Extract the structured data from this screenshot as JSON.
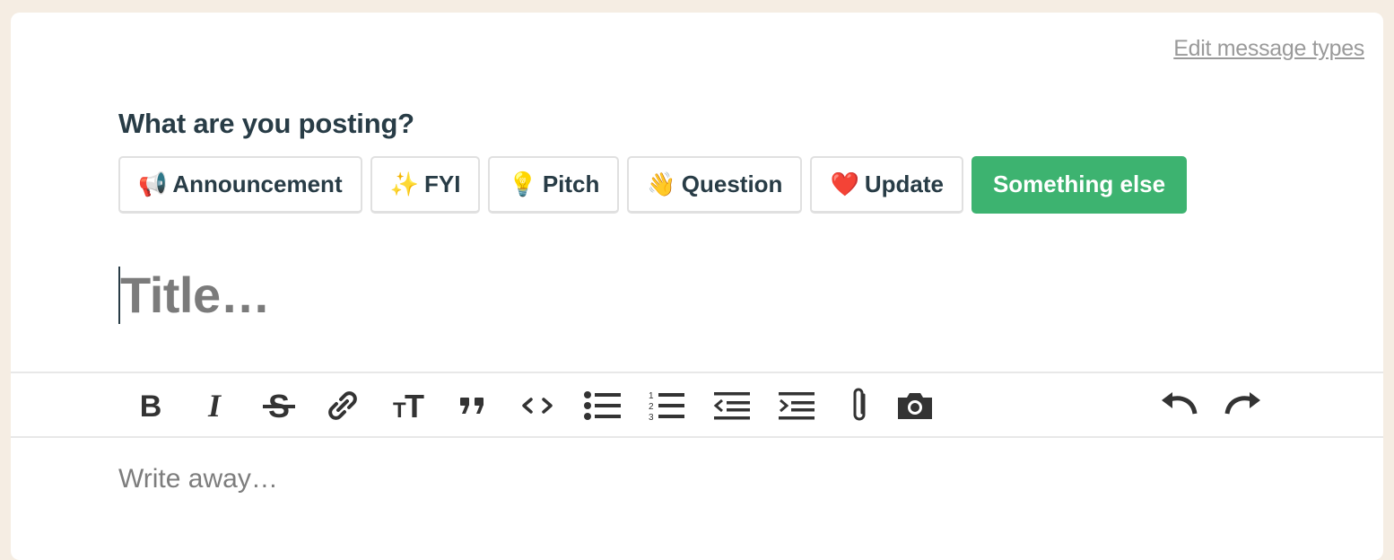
{
  "header": {
    "edit_link": "Edit message types"
  },
  "composer": {
    "heading": "What are you posting?",
    "types": [
      {
        "emoji": "📢",
        "label": "Announcement",
        "icon": "megaphone-icon",
        "selected": false
      },
      {
        "emoji": "✨",
        "label": "FYI",
        "icon": "sparkles-icon",
        "selected": false
      },
      {
        "emoji": "💡",
        "label": "Pitch",
        "icon": "lightbulb-icon",
        "selected": false
      },
      {
        "emoji": "👋",
        "label": "Question",
        "icon": "waving-hand-icon",
        "selected": false
      },
      {
        "emoji": "❤️",
        "label": "Update",
        "icon": "heart-icon",
        "selected": false
      },
      {
        "emoji": "",
        "label": "Something else",
        "icon": "",
        "selected": true
      }
    ],
    "title_placeholder": "Title…",
    "body_placeholder": "Write away…"
  },
  "toolbar": {
    "tools": [
      "bold-icon",
      "italic-icon",
      "strikethrough-icon",
      "link-icon",
      "heading-icon",
      "quote-icon",
      "code-icon",
      "bullet-list-icon",
      "numbered-list-icon",
      "outdent-icon",
      "indent-icon",
      "attachment-icon",
      "camera-icon",
      "undo-icon",
      "redo-icon"
    ]
  },
  "colors": {
    "accent": "#3db370",
    "text": "#283c46",
    "background": "#f5ede3"
  }
}
